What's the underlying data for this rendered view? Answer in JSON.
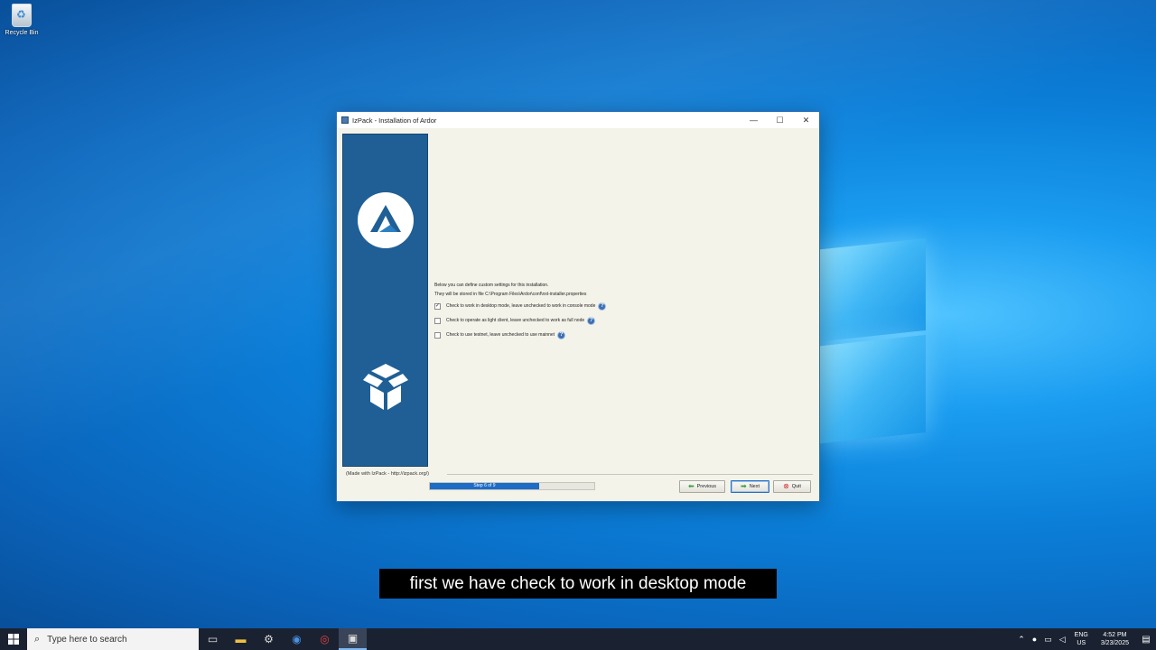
{
  "desktop": {
    "recycle_bin_label": "Recycle Bin"
  },
  "window": {
    "title": "IzPack - Installation of  Ardor",
    "controls": {
      "minimize": "—",
      "maximize": "☐",
      "close": "✕"
    }
  },
  "content": {
    "intro_line1": "Below you can define custom settings for this installation.",
    "intro_line2": "They will be stored in file C:\\Program Files\\Ardor\\conf\\nxt-installer.properties",
    "options": [
      {
        "label": "Check to work in desktop mode, leave unchecked to work in console mode",
        "checked": true
      },
      {
        "label": "Check to operate as light client, leave unchecked to work as full node",
        "checked": false
      },
      {
        "label": "Check to use testnet, leave unchecked to use mainnet",
        "checked": false
      }
    ],
    "help_glyph": "?"
  },
  "footer": {
    "made_with": "(Made with IzPack - http://izpack.org/)",
    "progress_text": "Step 6 of 9",
    "progress_fraction": 0.6667,
    "buttons": {
      "previous": "Previous",
      "next": "Next",
      "quit": "Quit"
    }
  },
  "caption": "first we have check to work in desktop mode",
  "taskbar": {
    "search_placeholder": "Type here to search",
    "lang_top": "ENG",
    "lang_bottom": "US",
    "time": "4:52 PM",
    "date": "3/23/2025"
  },
  "colors": {
    "side_panel": "#1f5f96",
    "progress": "#1c6cc8",
    "window_bg": "#f4f3ea"
  }
}
